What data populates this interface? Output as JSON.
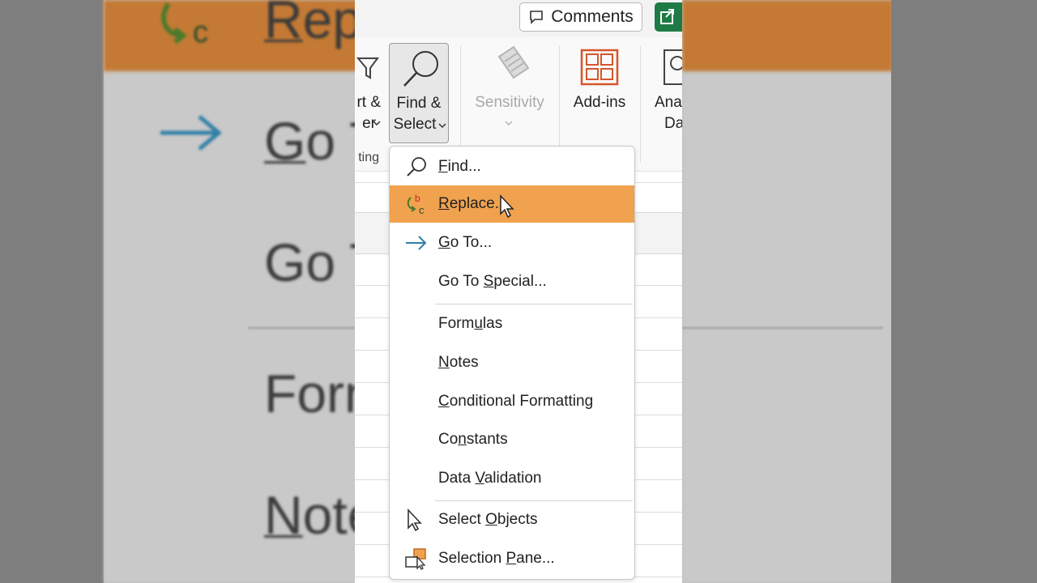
{
  "toolbar": {
    "comments_label": "Comments"
  },
  "ribbon": {
    "sort_filter_line1": "rt &",
    "sort_filter_line2": "er",
    "group_label": "ting",
    "find_select_line1": "Find &",
    "find_select_line2": "Select",
    "sensitivity_label": "Sensitivity",
    "addins_label": "Add-ins",
    "analyze_line1": "Ana",
    "analyze_line2": "Da"
  },
  "menu": {
    "find": {
      "pre": "",
      "ul": "F",
      "post": "ind..."
    },
    "replace": {
      "pre": "",
      "ul": "R",
      "post": "eplace..."
    },
    "goto": {
      "pre": "",
      "ul": "G",
      "post": "o To..."
    },
    "goto_special": {
      "pre": "Go To ",
      "ul": "S",
      "post": "pecial..."
    },
    "formulas": {
      "pre": "Form",
      "ul": "u",
      "post": "las"
    },
    "notes": {
      "pre": "",
      "ul": "N",
      "post": "otes"
    },
    "conditional": {
      "pre": "",
      "ul": "C",
      "post": "onditional Formatting"
    },
    "constants": {
      "pre": "Co",
      "ul": "n",
      "post": "stants"
    },
    "validation": {
      "pre": "Data ",
      "ul": "V",
      "post": "alidation"
    },
    "select_objects": {
      "pre": "Select ",
      "ul": "O",
      "post": "bjects"
    },
    "selection_pane": {
      "pre": "Selection ",
      "ul": "P",
      "post": "ane..."
    }
  },
  "background": {
    "rep": {
      "ul": "R",
      "post": "ep"
    },
    "goto1": {
      "ul": "G",
      "post": "o T"
    },
    "goto2": "Go T",
    "form": "Form",
    "note": {
      "ul": "N",
      "post": "ote"
    }
  },
  "colors": {
    "highlight": "#f0a24e",
    "share_green": "#1e7b45",
    "addins_orange": "#d2572b",
    "goto_arrow": "#2f7fa6"
  }
}
